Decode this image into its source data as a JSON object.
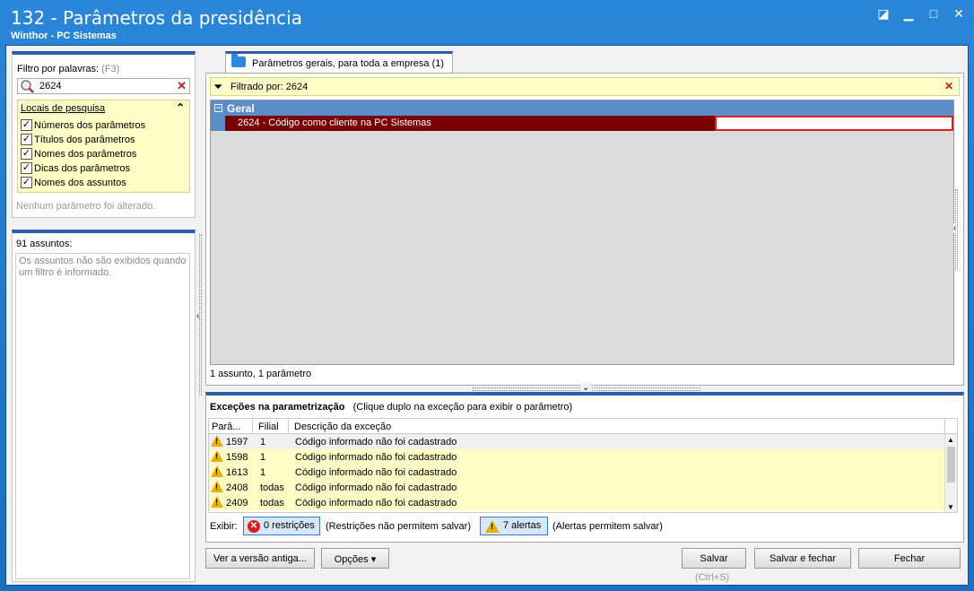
{
  "window": {
    "title": "132 - Parâmetros da presidência",
    "subtitle": "Winthor - PC Sistemas",
    "controls": [
      "restore-icon",
      "minimize-icon",
      "maximize-icon",
      "close-icon"
    ]
  },
  "filter": {
    "label": "Filtro por palavras:",
    "shortcut": "(F3)",
    "value": "2624",
    "locais_title": "Locais de pesquisa",
    "options": [
      {
        "label": "Números dos parâmetros",
        "checked": true
      },
      {
        "label": "Títulos dos parâmetros",
        "checked": true
      },
      {
        "label": "Nomes dos parâmetros",
        "checked": true
      },
      {
        "label": "Dicas dos parâmetros",
        "checked": true
      },
      {
        "label": "Nomes dos assuntos",
        "checked": true
      }
    ],
    "status": "Nenhum parâmetro foi alterado."
  },
  "assuntos": {
    "title": "91 assuntos:",
    "message": "Os assuntos não são exibidos quando um filtro é informado."
  },
  "tab": {
    "label": "Parâmetros gerais, para toda a empresa",
    "count": "(1)"
  },
  "filterbar": {
    "text": "Filtrado por: 2624"
  },
  "grid": {
    "group": "Geral",
    "row_label": "2624 - Código como cliente na PC Sistemas",
    "row_value": "",
    "status": "1 assunto, 1 parâmetro"
  },
  "exceptions": {
    "title": "Exceções na parametrização",
    "hint": "(Clique duplo na exceção para exibir o parâmetro)",
    "columns": [
      "Parâ...",
      "Filial",
      "Descrição da exceção"
    ],
    "rows": [
      {
        "param": "1597",
        "filial": "1",
        "desc": "Código informado não foi cadastrado"
      },
      {
        "param": "1598",
        "filial": "1",
        "desc": "Código informado não foi cadastrado"
      },
      {
        "param": "1613",
        "filial": "1",
        "desc": "Código informado não foi cadastrado"
      },
      {
        "param": "2408",
        "filial": "todas",
        "desc": "Código informado não foi cadastrado"
      },
      {
        "param": "2409",
        "filial": "todas",
        "desc": "Código informado não foi cadastrado"
      }
    ],
    "exibir_label": "Exibir:",
    "restricoes_btn": "0 restrições",
    "restricoes_note": "(Restrições não permitem salvar)",
    "alertas_btn": "7 alertas",
    "alertas_note": "(Alertas permitem salvar)"
  },
  "footer": {
    "ver_versao": "Ver a versão antiga...",
    "opcoes": "Opções",
    "salvar": "Salvar",
    "salvar_shortcut": "(Ctrl+S)",
    "salvar_fechar": "Salvar e fechar",
    "fechar": "Fechar"
  },
  "colors": {
    "title_bg": "#1a73c9",
    "selected_row": "#7a0000",
    "group_header": "#5b8ec6",
    "highlight_yellow": "#fdfbc6",
    "panel_border_top": "#2b5fa8"
  }
}
